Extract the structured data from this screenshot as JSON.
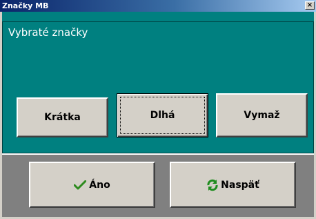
{
  "window": {
    "title": "Značky MB",
    "close_label": "×"
  },
  "panel": {
    "title": "Vybraté značky"
  },
  "buttons": {
    "short_label": "Krátka",
    "long_label": "Dlhá",
    "delete_label": "Vymaž",
    "yes_label": "Áno",
    "back_label": "Naspäť"
  },
  "icons": {
    "yes_icon": "check-icon",
    "back_icon": "refresh-icon"
  },
  "colors": {
    "panel_bg": "#008080",
    "bottom_bg": "#808080",
    "button_face": "#d4d0c8",
    "check_green": "#2e8b1f",
    "refresh_green": "#1e8c1e"
  }
}
